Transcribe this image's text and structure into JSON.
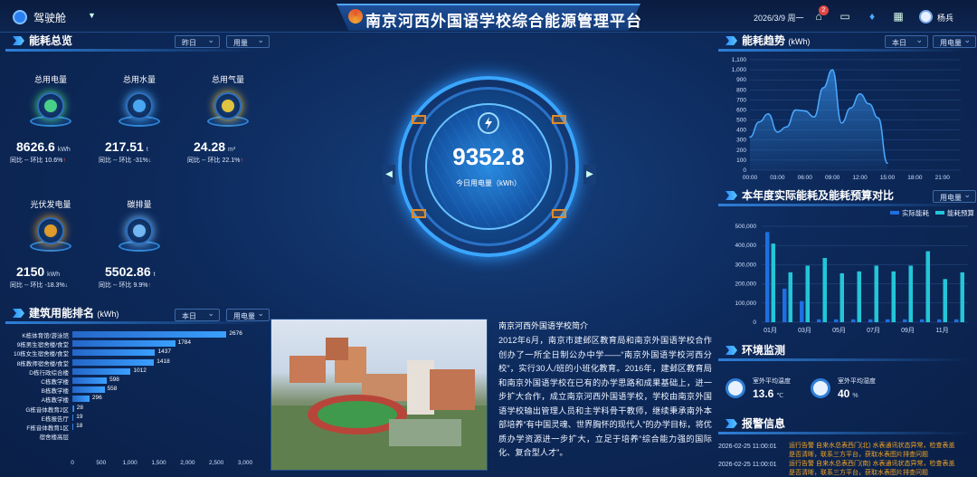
{
  "header": {
    "brand": "驾驶舱",
    "title": "南京河西外国语学校综合能源管理平台",
    "date": "2026/3/9 周一",
    "notification_count": "2",
    "username": "杨兵"
  },
  "energy_overview": {
    "title": "能耗总览",
    "period_select": "昨日",
    "type_select": "用量",
    "kpis": [
      {
        "label": "总用电量",
        "value": "8626.6",
        "unit": "kWh",
        "compare": "同比 -- 环比 10.6%",
        "arrow": "↑",
        "dir": "up",
        "icon": "electricity-icon"
      },
      {
        "label": "总用水量",
        "value": "217.51",
        "unit": "t",
        "compare": "同比 -- 环比 -31%",
        "arrow": "↓",
        "dir": "down",
        "icon": "water-drop-icon"
      },
      {
        "label": "总用气量",
        "value": "24.28",
        "unit": "m³",
        "compare": "同比 -- 环比 22.1%",
        "arrow": "↑",
        "dir": "up",
        "icon": "flame-icon"
      },
      {
        "label": "光伏发电量",
        "value": "2150",
        "unit": "kWh",
        "compare": "同比 -- 环比 -18.3%",
        "arrow": "↓",
        "dir": "down",
        "icon": "solar-flame-icon"
      },
      {
        "label": "碳排量",
        "value": "5502.86",
        "unit": "t",
        "compare": "同比 -- 环比 9.9%",
        "arrow": "↑",
        "dir": "up",
        "icon": "co2-icon"
      }
    ]
  },
  "center": {
    "value": "9352.8",
    "label": "今日用电量（kWh）"
  },
  "ranking": {
    "title": "建筑用能排名",
    "unit": "(kWh)",
    "period_select": "本日",
    "type_select": "用电量",
    "chart_data": {
      "type": "bar",
      "orientation": "horizontal",
      "categories": [
        "K栋体育馆/游泳馆",
        "9栋男生宿舍楼/食堂",
        "10栋女生宿舍楼/食堂",
        "8栋教师宿舍楼/食堂",
        "D栋行政综合楼",
        "C栋教学楼",
        "B栋教学楼",
        "A栋教学楼",
        "G栋音体教育2区",
        "E栋报告厅",
        "F栋音体教育1区",
        "宿舍楼高层"
      ],
      "values": [
        2676,
        1784,
        1437,
        1418,
        1012,
        598,
        558,
        296,
        28,
        19,
        18,
        0
      ],
      "xticks": [
        "0",
        "500",
        "1,000",
        "1,500",
        "2,000",
        "2,500",
        "3,000"
      ],
      "xlim": [
        0,
        3000
      ]
    }
  },
  "intro": {
    "title": "南京河西外国语学校简介",
    "text": "2012年6月，南京市建邺区教育局和南京外国语学校合作创办了一所全日制公办中学——“南京外国语学校河西分校”，实行30人/班的小班化教育。2016年，建邺区教育局和南京外国语学校在已有的办学思路和成果基础上，进一步扩大合作，成立南京河西外国语学校，学校由南京外国语学校输出管理人员和主学科骨干教师，继续秉承南外本部培养“有中国灵魂、世界胸怀的现代人”的办学目标，将优质办学资源进一步扩大，立足于培养“综合能力强的国际化、复合型人才”。"
  },
  "trend": {
    "title": "能耗趋势",
    "unit": "(kWh)",
    "period_select": "本日",
    "type_select": "用电量",
    "chart_data": {
      "type": "area",
      "x": [
        "00:00",
        "01:00",
        "02:00",
        "03:00",
        "04:00",
        "05:00",
        "06:00",
        "07:00",
        "08:00",
        "09:00",
        "10:00",
        "11:00",
        "12:00",
        "13:00",
        "14:00",
        "15:00"
      ],
      "values": [
        330,
        480,
        560,
        380,
        430,
        600,
        590,
        530,
        820,
        1000,
        470,
        620,
        760,
        660,
        520,
        70
      ],
      "xticks": [
        "00:00",
        "03:00",
        "06:00",
        "09:00",
        "12:00",
        "15:00",
        "18:00",
        "21:00"
      ],
      "yticks": [
        "0",
        "100",
        "200",
        "300",
        "400",
        "500",
        "600",
        "700",
        "800",
        "900",
        "1,000",
        "1,100"
      ],
      "ylim": [
        0,
        1100
      ],
      "xlim": [
        0,
        23
      ]
    }
  },
  "budget": {
    "title": "本年度实际能耗及能耗预算对比",
    "type_select": "用电量",
    "chart_data": {
      "type": "bar",
      "categories": [
        "01月",
        "02月",
        "03月",
        "04月",
        "05月",
        "06月",
        "07月",
        "08月",
        "09月",
        "10月",
        "11月",
        "12月"
      ],
      "series": [
        {
          "name": "实际能耗",
          "values": [
            470000,
            175000,
            110000,
            15000,
            15000,
            15000,
            15000,
            15000,
            15000,
            15000,
            15000,
            15000
          ]
        },
        {
          "name": "能耗预算",
          "values": [
            410000,
            260000,
            295000,
            335000,
            255000,
            265000,
            295000,
            265000,
            295000,
            370000,
            225000,
            260000
          ]
        }
      ],
      "xticks": [
        "01月",
        "03月",
        "05月",
        "07月",
        "09月",
        "11月"
      ],
      "yticks": [
        "0",
        "100,000",
        "200,000",
        "300,000",
        "400,000",
        "500,000"
      ],
      "ylim": [
        0,
        500000
      ]
    }
  },
  "env": {
    "title": "环境监测",
    "items": [
      {
        "label": "室外平均温度",
        "value": "13.6",
        "unit": "℃"
      },
      {
        "label": "室外平均湿度",
        "value": "40",
        "unit": "%"
      }
    ]
  },
  "alarms": {
    "title": "报警信息",
    "items": [
      {
        "time": "2026-02-25 11:00:01",
        "text": "运行告警 自来水总表西门(北) 水表通讯状态异常，检查表盖是否清晰，联系三方平台，获取水表图片排查问题"
      },
      {
        "time": "2026-02-25 11:00:01",
        "text": "运行告警 自来水总表西门(南) 水表通讯状态异常，检查表盖是否清晰，联系三方平台，获取水表图片排查问题"
      }
    ]
  },
  "colors": {
    "accent": "#3aa0ff",
    "actual": "#1f6fe0",
    "budget": "#22c6d8",
    "alarm": "#f5a623",
    "up": "#ff5a4d"
  }
}
